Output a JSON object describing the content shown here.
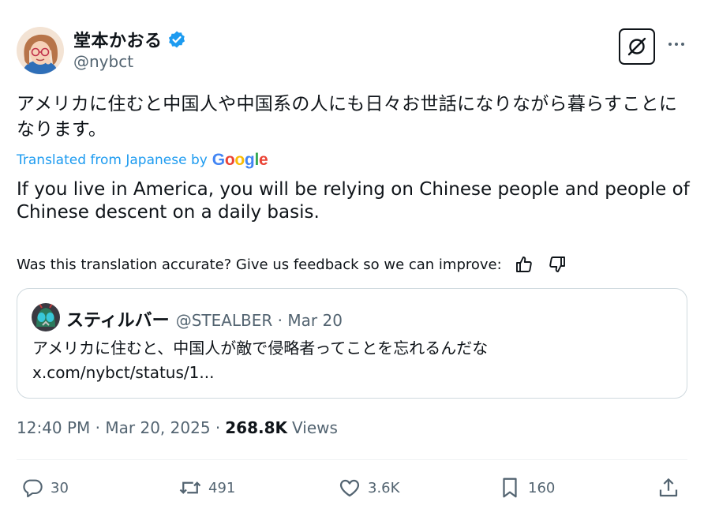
{
  "author": {
    "display_name": "堂本かおる",
    "handle": "@nybct",
    "verified": true
  },
  "tweet": {
    "text": "アメリカに住むと中国人や中国系の人にも日々お世話になりながら暮らすことになります。",
    "translated_label": "Translated from Japanese by",
    "translator_brand": "Google",
    "translation": "If you live in America, you will be relying on Chinese people and people of Chinese descent on a daily basis.",
    "feedback_prompt": "Was this translation accurate? Give us feedback so we can improve:"
  },
  "quote": {
    "display_name": "スティルバー",
    "handle_date": "@STEALBER · Mar 20",
    "text": "アメリカに住むと、中国人が敵で侵略者ってことを忘れるんだな",
    "link": "x.com/nybct/status/1..."
  },
  "meta": {
    "time_date": "12:40 PM · Mar 20, 2025 ·",
    "views_count": "268.8K",
    "views_label": "Views"
  },
  "actions": {
    "replies": "30",
    "reposts": "491",
    "likes": "3.6K",
    "bookmarks": "160"
  },
  "icons": [
    "grok-icon",
    "more-icon",
    "verified-icon",
    "thumbs-up-icon",
    "thumbs-down-icon",
    "reply-icon",
    "repost-icon",
    "like-icon",
    "bookmark-icon",
    "share-icon"
  ],
  "colors": {
    "text": "#0f1419",
    "secondary": "#536471",
    "accent": "#1d9bf0",
    "border": "#cfd9de",
    "google_blue": "#4285F4",
    "google_red": "#EA4335",
    "google_yellow": "#FBBC05",
    "google_green": "#34A853"
  }
}
